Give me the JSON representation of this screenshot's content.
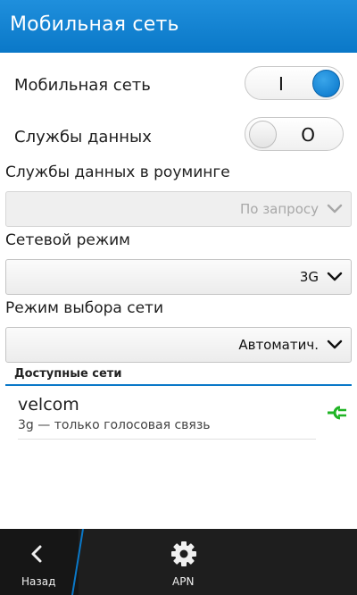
{
  "title_bar": {
    "title": "Мобильная сеть"
  },
  "toggles": {
    "mobile_network": {
      "label": "Мобильная сеть",
      "state_text": "I",
      "on": true
    },
    "data_services": {
      "label": "Службы данных",
      "state_text": "O",
      "on": false
    }
  },
  "roaming": {
    "label": "Службы данных в роуминге",
    "value": "По запросу",
    "enabled": false
  },
  "network_mode": {
    "label": "Сетевой режим",
    "value": "3G"
  },
  "selection_mode": {
    "label": "Режим выбора сети",
    "value": "Автоматич."
  },
  "available_networks": {
    "header": "Доступные сети",
    "items": [
      {
        "name": "velcom",
        "description": "3g — только голосовая связь",
        "icon": "connected-plug-icon"
      }
    ]
  },
  "action_bar": {
    "back_label": "Назад",
    "apn_label": "APN"
  },
  "colors": {
    "accent": "#0a78c8",
    "connected": "#1fb424",
    "bar": "#1e1e1e"
  }
}
